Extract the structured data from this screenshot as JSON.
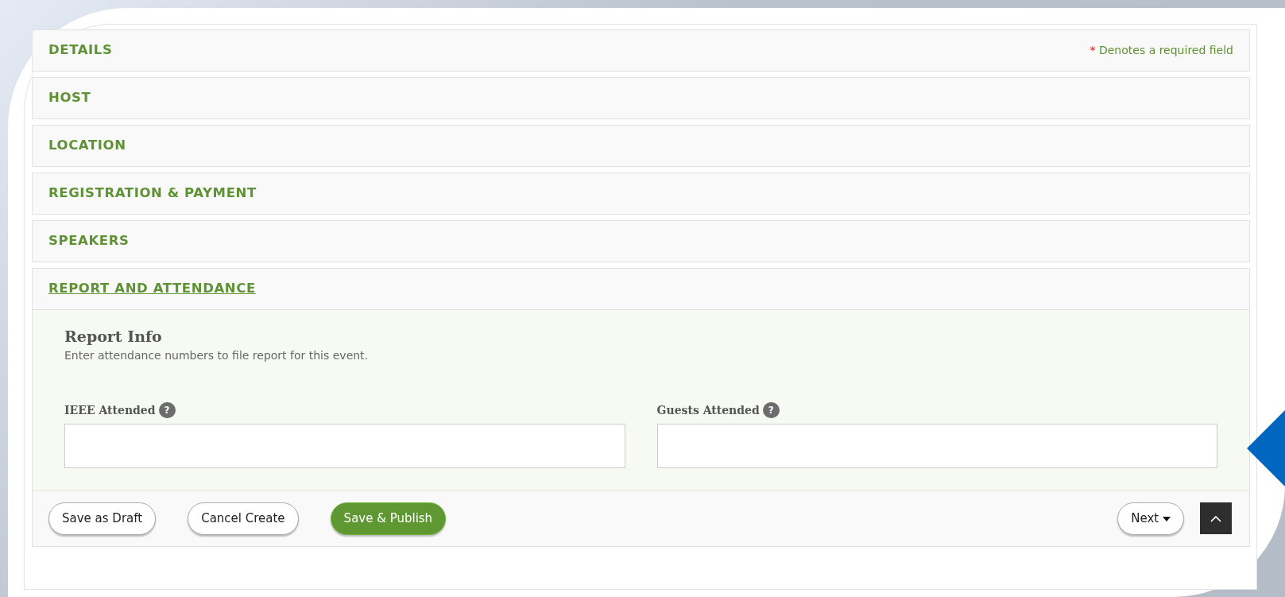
{
  "required_note": {
    "marker": "*",
    "text": "Denotes a required field"
  },
  "sections": [
    {
      "title": "DETAILS",
      "expanded": false
    },
    {
      "title": "HOST",
      "expanded": false
    },
    {
      "title": "LOCATION",
      "expanded": false
    },
    {
      "title": "REGISTRATION & PAYMENT",
      "expanded": false
    },
    {
      "title": "SPEAKERS",
      "expanded": false
    },
    {
      "title": "REPORT AND ATTENDANCE",
      "expanded": true
    }
  ],
  "report": {
    "heading": "Report Info",
    "description": "Enter attendance numbers to file report for this event.",
    "fields": [
      {
        "label": "IEEE Attended",
        "help": "?"
      },
      {
        "label": "Guests Attended",
        "help": "?"
      }
    ]
  },
  "buttons": [
    {
      "label": "Save as Draft",
      "kind": "outline"
    },
    {
      "label": "Cancel Create",
      "kind": "outline"
    },
    {
      "label": "Save & Publish",
      "kind": "primary"
    }
  ],
  "next_button": {
    "label": "Next"
  }
}
